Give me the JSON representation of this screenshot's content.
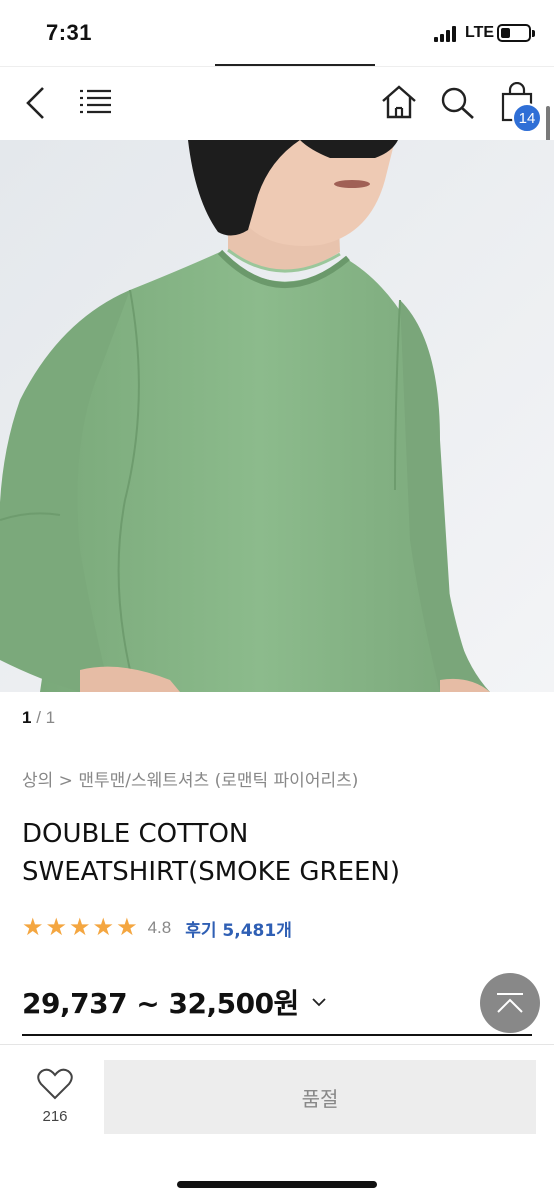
{
  "status_bar": {
    "time": "7:31",
    "network": "LTE",
    "battery_level": 0.35
  },
  "nav": {
    "icons": [
      "back-chevron-icon",
      "menu-icon",
      "home-icon",
      "search-icon",
      "cart-icon"
    ],
    "cart_count": "14"
  },
  "gallery": {
    "current": "1",
    "separator_total": " / 1"
  },
  "product": {
    "breadcrumb": "상의 > 맨투맨/스웨트셔츠 (로맨틱 파이어리츠)",
    "title": "DOUBLE COTTON SWEATSHIRT(SMOKE GREEN)",
    "rating": "4.8",
    "stars": 5,
    "reviews_label": "후기 5,481개",
    "price_range": "29,737 ~ 32,500원"
  },
  "bottom_bar": {
    "like_count": "216",
    "sold_out_label": "품절"
  },
  "colors": {
    "accent": "#2f6fd6",
    "star": "#f4a640",
    "review_link": "#2f5fb4",
    "sweatshirt": "#86b386",
    "button_bg": "#ededed"
  }
}
